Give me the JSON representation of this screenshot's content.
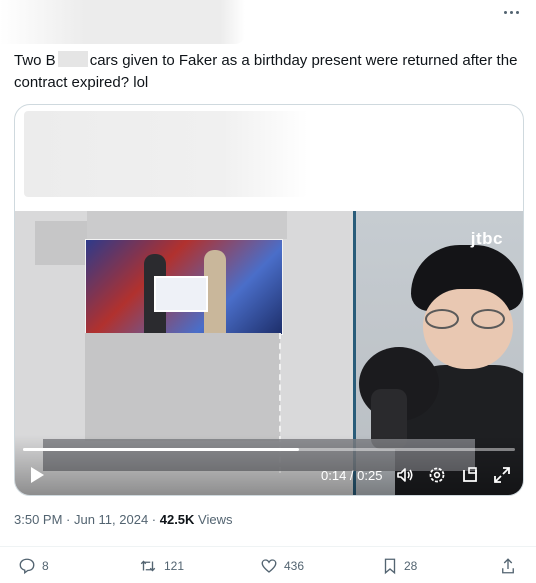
{
  "post": {
    "text_part1": "Two B",
    "text_part2": "cars given to Faker as a birthday present were returned after the contract expired? lol"
  },
  "video": {
    "channel_logo": "jtbc",
    "progress": 0.56,
    "time": "0:14 / 0:25"
  },
  "meta": {
    "timestamp": "3:50 PM · Jun 11, 2024 · ",
    "views_count": "42.5K",
    "views_label": " Views"
  },
  "actions": {
    "replies": "8",
    "reposts": "121",
    "likes": "436",
    "bookmarks": "28"
  },
  "icons": [
    "more-icon",
    "play-icon",
    "volume-icon",
    "settings-icon",
    "miniplayer-icon",
    "fullscreen-icon",
    "reply-icon",
    "repost-icon",
    "like-icon",
    "bookmark-icon",
    "share-icon"
  ]
}
